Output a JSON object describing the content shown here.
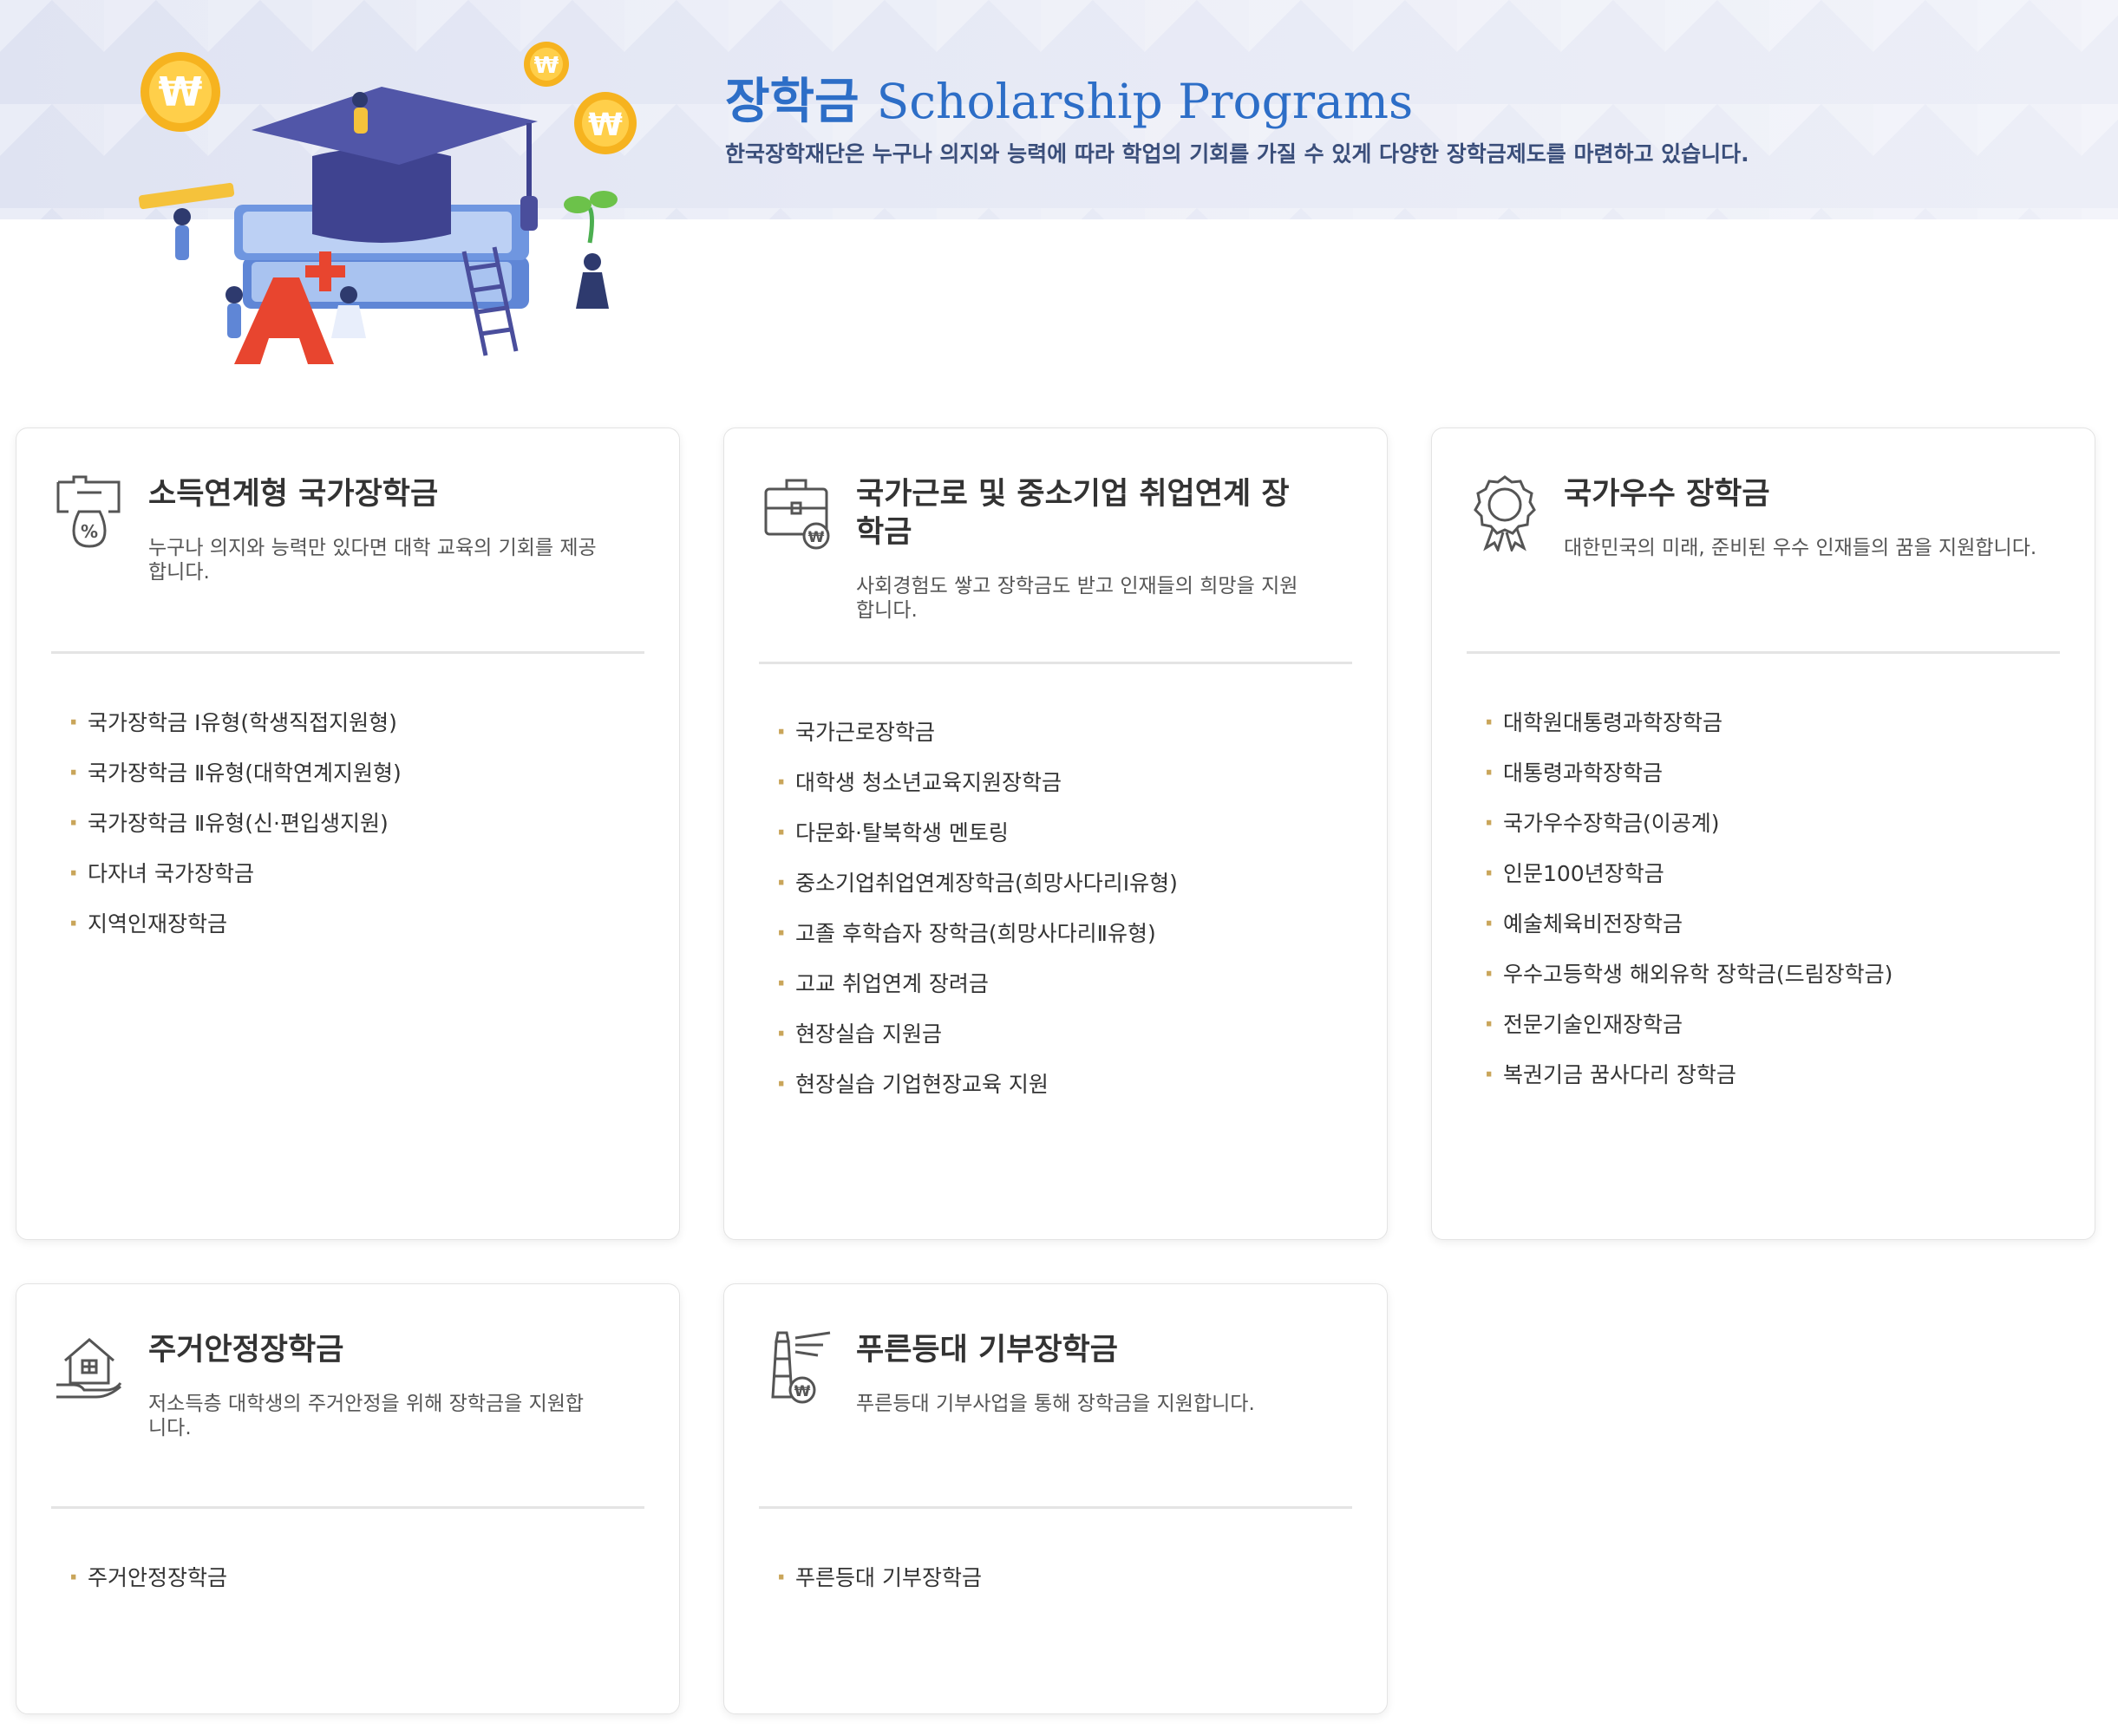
{
  "banner": {
    "title_ko": "장학금",
    "title_en": "Scholarship Programs",
    "subtitle": "한국장학재단은 누구나 의지와 능력에 따라 학업의 기회를 가질 수 있게 다양한 장학금제도를 마련하고 있습니다."
  },
  "colors": {
    "accent": "#2d6ec7",
    "bullet": "#c9a55a",
    "illustration_cap": "#4a4e9c",
    "illustration_book": "#7da0e0",
    "coin": "#f6b31f"
  },
  "cards": [
    {
      "icon": "money-bag-percent-icon",
      "title": "소득연계형 국가장학금",
      "desc": "누구나 의지와 능력만 있다면 대학 교육의 기회를 제공합니다.",
      "items": [
        "국가장학금 Ⅰ유형(학생직접지원형)",
        "국가장학금 Ⅱ유형(대학연계지원형)",
        "국가장학금 Ⅱ유형(신·편입생지원)",
        "다자녀 국가장학금",
        "지역인재장학금"
      ]
    },
    {
      "icon": "briefcase-won-icon",
      "title": "국가근로 및 중소기업 취업연계 장학금",
      "desc": "사회경험도 쌓고 장학금도 받고 인재들의 희망을 지원합니다.",
      "items": [
        "국가근로장학금",
        "대학생 청소년교육지원장학금",
        "다문화·탈북학생 멘토링",
        "중소기업취업연계장학금(희망사다리Ⅰ유형)",
        "고졸 후학습자 장학금(희망사다리Ⅱ유형)",
        "고교 취업연계 장려금",
        "현장실습 지원금",
        "현장실습 기업현장교육 지원"
      ]
    },
    {
      "icon": "medal-ribbon-icon",
      "title": "국가우수 장학금",
      "desc": "대한민국의 미래, 준비된 우수 인재들의 꿈을 지원합니다.",
      "items": [
        "대학원대통령과학장학금",
        "대통령과학장학금",
        "국가우수장학금(이공계)",
        "인문100년장학금",
        "예술체육비전장학금",
        "우수고등학생 해외유학 장학금(드림장학금)",
        "전문기술인재장학금",
        "복권기금 꿈사다리 장학금"
      ]
    },
    {
      "icon": "house-hand-icon",
      "title": "주거안정장학금",
      "desc": "저소득층 대학생의 주거안정을 위해 장학금을 지원합니다.",
      "items": [
        "주거안정장학금"
      ]
    },
    {
      "icon": "lighthouse-won-icon",
      "title": "푸른등대 기부장학금",
      "desc": "푸른등대 기부사업을 통해 장학금을 지원합니다.",
      "items": [
        "푸른등대 기부장학금"
      ]
    }
  ]
}
